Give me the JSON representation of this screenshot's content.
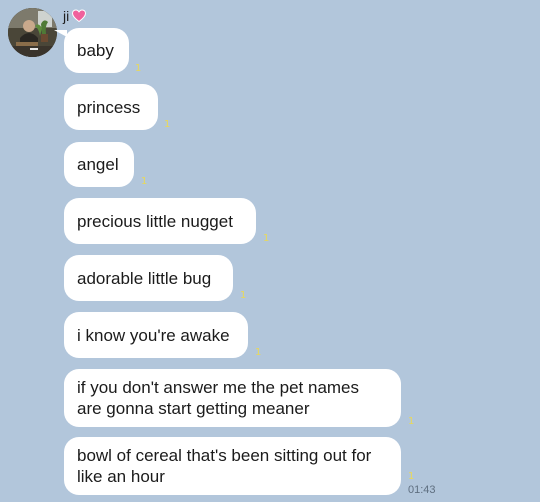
{
  "chat": {
    "sender": {
      "name": "ji",
      "emoji_icon": "pink-heart-icon",
      "avatar": "profile-photo"
    },
    "messages": [
      {
        "text": "baby",
        "read_mark": "1"
      },
      {
        "text": "princess",
        "read_mark": "1"
      },
      {
        "text": "angel",
        "read_mark": "1"
      },
      {
        "text": "precious little nugget",
        "read_mark": "1"
      },
      {
        "text": "adorable little bug",
        "read_mark": "1"
      },
      {
        "text": "i know you're awake",
        "read_mark": "1"
      },
      {
        "text": "if you don't answer me the pet names are gonna start getting meaner",
        "read_mark": "1"
      },
      {
        "text": "bowl of cereal that's been sitting out for like an hour",
        "read_mark": "1"
      }
    ],
    "last_time": "01:43"
  },
  "colors": {
    "background": "#b2c6db",
    "bubble": "#ffffff",
    "heart": "#f0619c",
    "read_mark": "#e8d85a",
    "time": "#5f6f80"
  }
}
